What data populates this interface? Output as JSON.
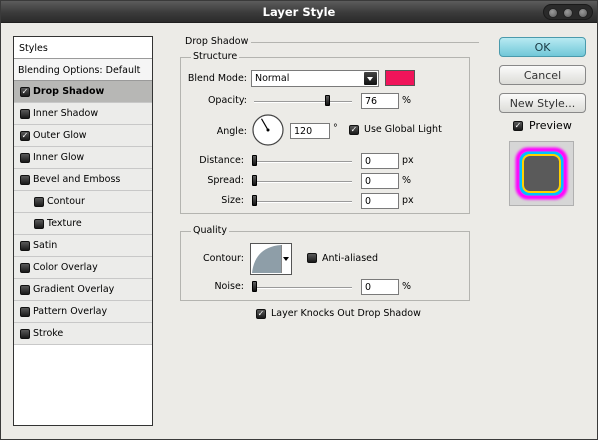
{
  "window": {
    "title": "Layer Style"
  },
  "styles_panel": {
    "header": "Styles",
    "blending_options": "Blending Options: Default",
    "items": [
      {
        "label": "Drop Shadow",
        "checked": true,
        "selected": true,
        "indent": false
      },
      {
        "label": "Inner Shadow",
        "checked": false,
        "selected": false,
        "indent": false
      },
      {
        "label": "Outer Glow",
        "checked": true,
        "selected": false,
        "indent": false
      },
      {
        "label": "Inner Glow",
        "checked": false,
        "selected": false,
        "indent": false
      },
      {
        "label": "Bevel and Emboss",
        "checked": false,
        "selected": false,
        "indent": false
      },
      {
        "label": "Contour",
        "checked": false,
        "selected": false,
        "indent": true
      },
      {
        "label": "Texture",
        "checked": false,
        "selected": false,
        "indent": true
      },
      {
        "label": "Satin",
        "checked": false,
        "selected": false,
        "indent": false
      },
      {
        "label": "Color Overlay",
        "checked": false,
        "selected": false,
        "indent": false
      },
      {
        "label": "Gradient Overlay",
        "checked": false,
        "selected": false,
        "indent": false
      },
      {
        "label": "Pattern Overlay",
        "checked": false,
        "selected": false,
        "indent": false
      },
      {
        "label": "Stroke",
        "checked": false,
        "selected": false,
        "indent": false
      }
    ]
  },
  "drop_shadow": {
    "title": "Drop Shadow",
    "structure": {
      "title": "Structure",
      "blend_mode_label": "Blend Mode:",
      "blend_mode_value": "Normal",
      "shadow_color": "#f0145a",
      "opacity_label": "Opacity:",
      "opacity_value": "76",
      "opacity_unit": "%",
      "opacity_fraction": 0.76,
      "angle_label": "Angle:",
      "angle_value": "120",
      "angle_unit": "°",
      "use_global_light_label": "Use Global Light",
      "use_global_light": true,
      "distance_label": "Distance:",
      "distance_value": "0",
      "distance_unit": "px",
      "spread_label": "Spread:",
      "spread_value": "0",
      "spread_unit": "%",
      "size_label": "Size:",
      "size_value": "0",
      "size_unit": "px"
    },
    "quality": {
      "title": "Quality",
      "contour_label": "Contour:",
      "anti_aliased_label": "Anti-aliased",
      "anti_aliased": false,
      "noise_label": "Noise:",
      "noise_value": "0",
      "noise_unit": "%"
    },
    "knockout_label": "Layer Knocks Out Drop Shadow",
    "knockout": true
  },
  "buttons": {
    "ok": "OK",
    "cancel": "Cancel",
    "new_style": "New Style...",
    "preview_label": "Preview",
    "preview_checked": true
  }
}
